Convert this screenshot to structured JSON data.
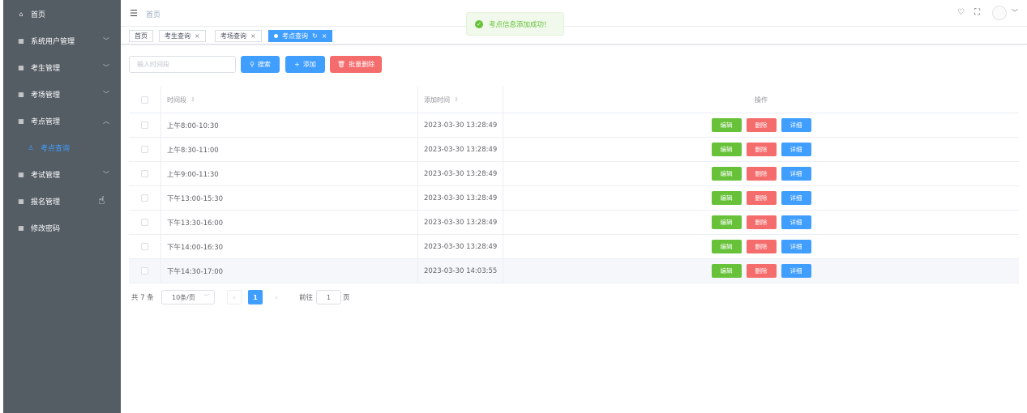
{
  "sidebar": {
    "items": [
      {
        "icon": "home-icon",
        "label": "首页"
      },
      {
        "icon": "grid-icon",
        "label": "系统用户管理",
        "arrow": "﹀"
      },
      {
        "icon": "grid-icon",
        "label": "考生管理",
        "arrow": "﹀"
      },
      {
        "icon": "grid-icon",
        "label": "考场管理",
        "arrow": "﹀"
      },
      {
        "icon": "grid-icon",
        "label": "考点管理",
        "arrow": "︿"
      },
      {
        "icon": "user-icon",
        "label": "考点查询"
      },
      {
        "icon": "grid-icon",
        "label": "考试管理",
        "arrow": "﹀"
      },
      {
        "icon": "grid-icon",
        "label": "报名管理"
      },
      {
        "icon": "grid-icon",
        "label": "修改密码"
      }
    ]
  },
  "header": {
    "breadcrumb": "首页"
  },
  "toast": {
    "message": "考点信息添加成功!"
  },
  "tags": [
    {
      "label": "首页"
    },
    {
      "label": "考生查询",
      "close": "×"
    },
    {
      "label": "考场查询",
      "close": "×"
    },
    {
      "label": "考点查询",
      "close": "×",
      "refresh": "↻"
    }
  ],
  "toolbar": {
    "search_placeholder": "输入时间段",
    "search_label": "搜索",
    "add_label": "添加",
    "batch_delete_label": "批量删除"
  },
  "table": {
    "columns": [
      "时间段",
      "添加时间",
      "操作"
    ],
    "sort_icon": "⇕",
    "actions": {
      "edit": "编辑",
      "delete": "删除",
      "detail": "详细"
    },
    "rows": [
      {
        "time": "上午8:00-10:30",
        "added": "2023-03-30 13:28:49"
      },
      {
        "time": "上午8:30-11:00",
        "added": "2023-03-30 13:28:49"
      },
      {
        "time": "上午9:00-11:30",
        "added": "2023-03-30 13:28:49"
      },
      {
        "time": "下午13:00-15:30",
        "added": "2023-03-30 13:28:49"
      },
      {
        "time": "下午13:30-16:00",
        "added": "2023-03-30 13:28:49"
      },
      {
        "time": "下午14:00-16:30",
        "added": "2023-03-30 13:28:49"
      },
      {
        "time": "下午14:30-17:00",
        "added": "2023-03-30 14:03:55"
      }
    ]
  },
  "pagination": {
    "total_text": "共 7 条",
    "page_size": "10条/页",
    "prev": "‹",
    "current_page": "1",
    "next": "›",
    "goto_label": "前往",
    "goto_value": "1",
    "page_suffix": "页"
  },
  "colors": {
    "sidebar_bg": "#545c64",
    "primary": "#409eff",
    "success": "#67c23a",
    "danger": "#f56c6c"
  }
}
